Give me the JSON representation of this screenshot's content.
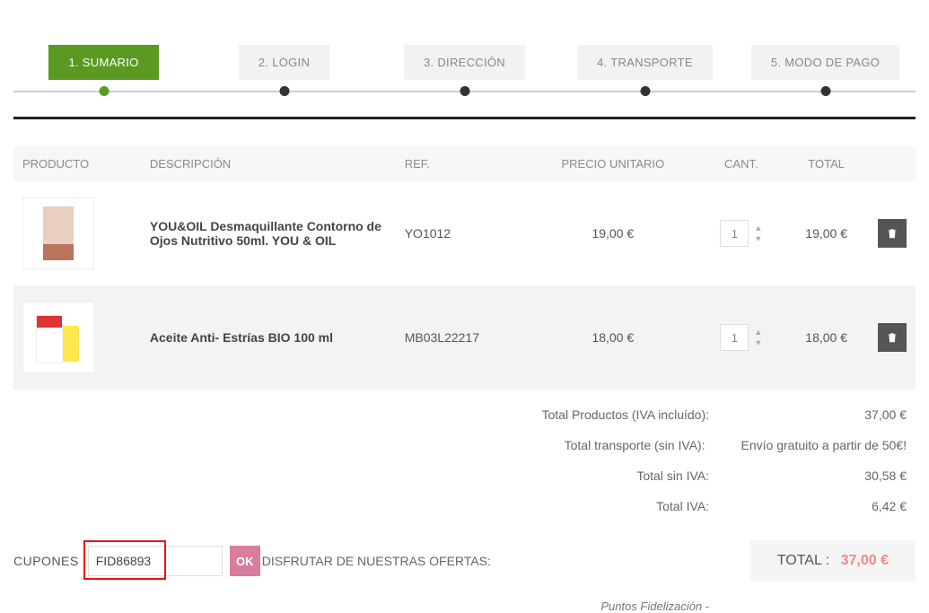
{
  "steps": {
    "items": [
      {
        "label": "1. SUMARIO"
      },
      {
        "label": "2. LOGIN"
      },
      {
        "label": "3. DIRECCIÓN"
      },
      {
        "label": "4. TRANSPORTE"
      },
      {
        "label": "5. MODO DE PAGO"
      }
    ]
  },
  "table": {
    "headers": {
      "product": "PRODUCTO",
      "description": "DESCRIPCIÓN",
      "ref": "REF.",
      "unit_price": "PRECIO UNITARIO",
      "qty": "CANT.",
      "total": "TOTAL"
    },
    "rows": [
      {
        "description": "YOU&OIL Desmaquillante Contorno de Ojos Nutritivo 50ml. YOU & OIL",
        "ref": "YO1012",
        "unit_price": "19,00 €",
        "qty": "1",
        "total": "19,00 €"
      },
      {
        "description": "Aceite Anti- Estrías BIO 100 ml",
        "ref": "MB03L22217",
        "unit_price": "18,00 €",
        "qty": "1",
        "total": "18,00 €"
      }
    ]
  },
  "totals": {
    "products_label": "Total Productos (IVA incluído):",
    "products_value": "37,00 €",
    "shipping_label": "Total transporte (sin IVA):",
    "shipping_value": "Envío gratuito a partir de 50€!",
    "without_vat_label": "Total sin IVA:",
    "without_vat_value": "30,58 €",
    "vat_label": "Total IVA:",
    "vat_value": "6,42 €"
  },
  "coupon": {
    "label": "CUPONES",
    "value": "FID86893",
    "ok": "OK",
    "offers": "DISFRUTAR DE NUESTRAS OFERTAS:"
  },
  "grand_total": {
    "label": "TOTAL :",
    "value": "37,00 €"
  },
  "loyalty": "Puntos Fidelización -"
}
